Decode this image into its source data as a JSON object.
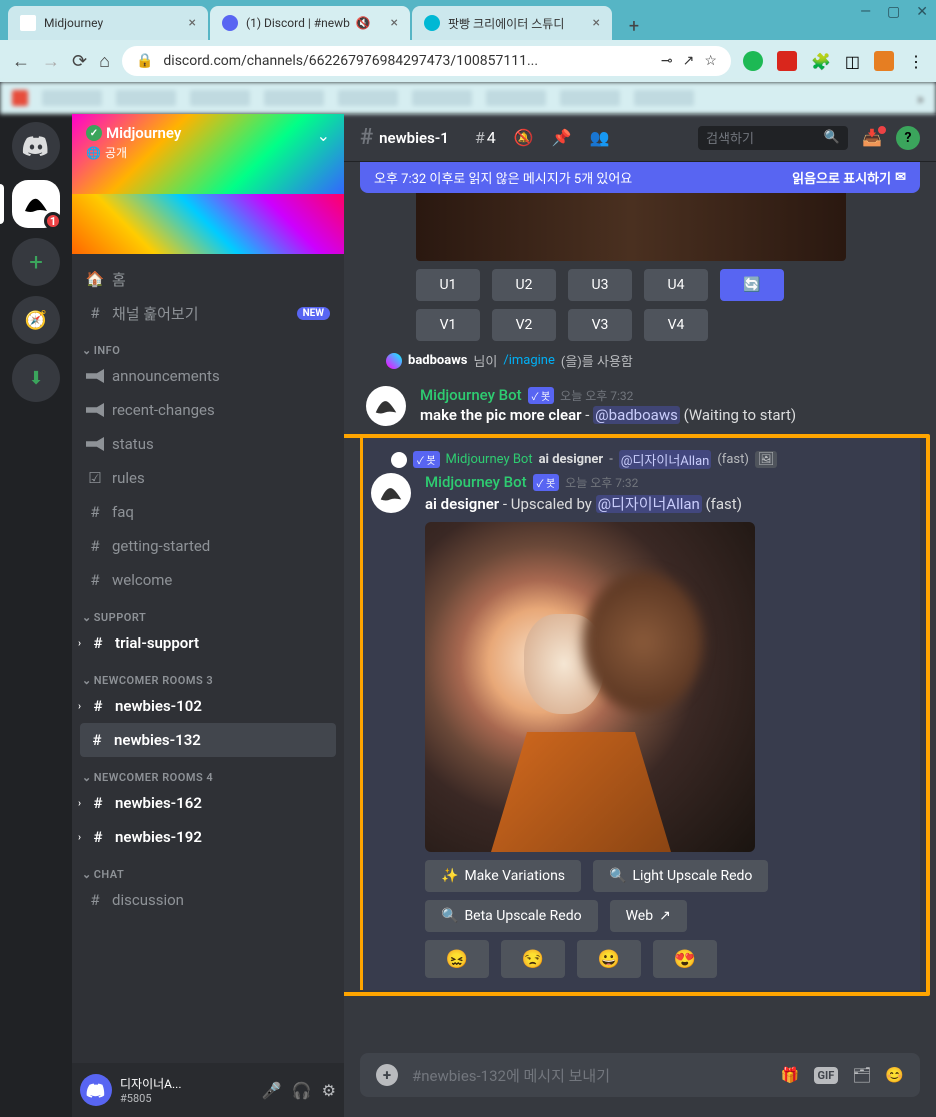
{
  "browser": {
    "tabs": [
      {
        "title": "Midjourney",
        "active": false
      },
      {
        "title": "(1) Discord | #newb",
        "active": true
      },
      {
        "title": "팟빵 크리에이터 스튜디",
        "active": false
      }
    ],
    "url": "discord.com/channels/662267976984297473/100857111...",
    "window_controls": {
      "minimize": "—",
      "maximize": "▢",
      "close": "✕"
    }
  },
  "discord": {
    "server_rail": {
      "active_badge": "1"
    },
    "server": {
      "name": "Midjourney",
      "verified_icon": "verified-check-icon",
      "public_label": "공개",
      "public_icon": "globe-icon"
    },
    "sidebar": {
      "home": "홈",
      "explore": "채널 훑어보기",
      "new_badge": "NEW",
      "categories": [
        {
          "name": "INFO",
          "items": [
            {
              "icon": "announce-icon",
              "label": "announcements"
            },
            {
              "icon": "announce-icon",
              "label": "recent-changes"
            },
            {
              "icon": "announce-icon",
              "label": "status"
            },
            {
              "icon": "rules-icon",
              "label": "rules"
            },
            {
              "icon": "hash-icon",
              "label": "faq"
            },
            {
              "icon": "hash-icon",
              "label": "getting-started"
            },
            {
              "icon": "hash-icon",
              "label": "welcome"
            }
          ]
        },
        {
          "name": "SUPPORT",
          "items": [
            {
              "icon": "hash-icon",
              "label": "trial-support",
              "bold": true
            }
          ]
        },
        {
          "name": "NEWCOMER ROOMS 3",
          "items": [
            {
              "icon": "hash-lock-icon",
              "label": "newbies-102",
              "bold": true
            },
            {
              "icon": "hash-lock-icon",
              "label": "newbies-132",
              "bold": true,
              "selected": true
            }
          ]
        },
        {
          "name": "NEWCOMER ROOMS 4",
          "items": [
            {
              "icon": "hash-lock-icon",
              "label": "newbies-162",
              "bold": true
            },
            {
              "icon": "hash-lock-icon",
              "label": "newbies-192",
              "bold": true
            }
          ]
        },
        {
          "name": "CHAT",
          "items": [
            {
              "icon": "hash-icon",
              "label": "discussion"
            }
          ]
        }
      ]
    },
    "user_panel": {
      "name": "디자이너A...",
      "tag": "#5805"
    },
    "channel_header": {
      "hash": "#",
      "name": "newbies-1",
      "thread_count": "4",
      "search_placeholder": "검색하기"
    },
    "unread_banner": {
      "text": "오후 7:32 이후로 읽지 않은 메시지가 5개 있어요",
      "action": "읽음으로 표시하기"
    },
    "messages": {
      "upscale_buttons": {
        "u1": "U1",
        "u2": "U2",
        "u3": "U3",
        "u4": "U4"
      },
      "variation_buttons": {
        "v1": "V1",
        "v2": "V2",
        "v3": "V3",
        "v4": "V4"
      },
      "reply1": {
        "user": "badboaws",
        "suffix_before": " 님이 ",
        "command": "/imagine",
        "suffix_after": "(을)를 사용함"
      },
      "msg1": {
        "bot": "Midjourney Bot",
        "bot_tag": "✓ 봇",
        "time": "오늘 오후 7:32",
        "text_prefix": "make the pic more clear",
        "dash": " - ",
        "mention": "@badboaws",
        "status": " (Waiting to start)"
      },
      "reply2": {
        "bot": "Midjourney Bot",
        "prompt": "ai designer",
        "dash": " - ",
        "mention": "@디자이너Allan",
        "fast": " (fast)"
      },
      "msg2": {
        "bot": "Midjourney Bot",
        "bot_tag": "✓ 봇",
        "time": "오늘 오후 7:32",
        "prompt": "ai designer",
        "action": " - Upscaled by ",
        "mention": "@디자이너Allan",
        "fast": " (fast)",
        "buttons": {
          "make_variations": "Make Variations",
          "light_upscale": "Light Upscale Redo",
          "beta_upscale": "Beta Upscale Redo",
          "web": "Web"
        },
        "emojis": {
          "e1": "😖",
          "e2": "😒",
          "e3": "😀",
          "e4": "😍"
        }
      }
    },
    "input": {
      "placeholder": "#newbies-132에 메시지 보내기"
    }
  }
}
